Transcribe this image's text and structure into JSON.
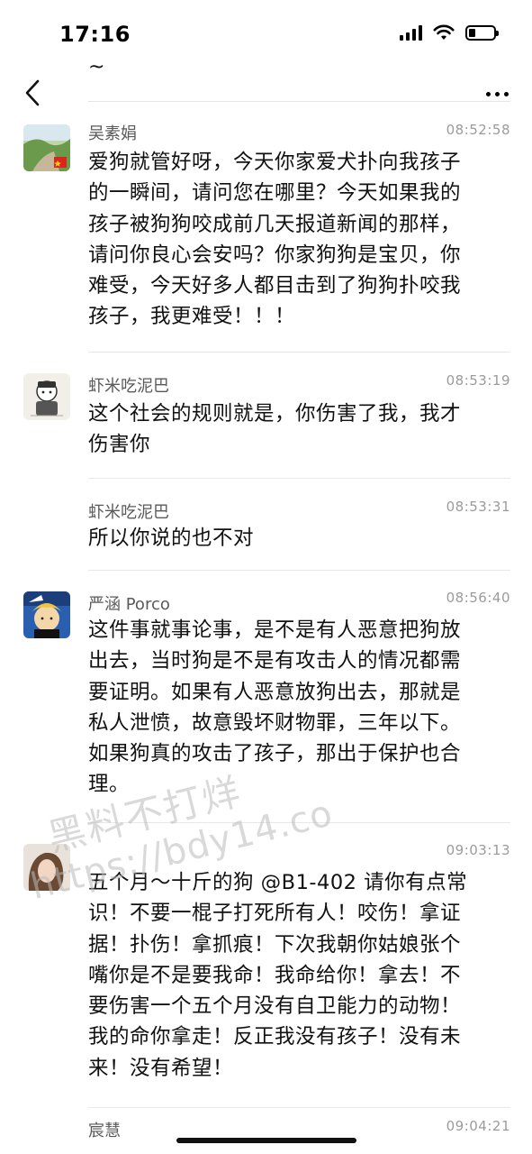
{
  "status_bar": {
    "time": "17:16",
    "battery_icon": "battery-icon",
    "wifi_icon": "wifi-icon",
    "signal_icon": "signal-icon"
  },
  "nav": {
    "tilde": "~",
    "back_icon": "chevron-left-icon",
    "more_icon": "more-horizontal-icon"
  },
  "comments": [
    {
      "name": "吴素娟",
      "time": "08:52:58",
      "text": "爱狗就管好呀，今天你家爱犬扑向我孩子\n的一瞬间，请问您在哪里？今天如果我的\n孩子被狗狗咬成前几天报道新闻的那样，\n请问你良心会安吗？你家狗狗是宝贝，你\n难受，今天好多人都目击到了狗狗扑咬我\n孩子，我更难受！！！"
    },
    {
      "name": "虾米吃泥巴",
      "time": "08:53:19",
      "text": "这个社会的规则就是，你伤害了我，我才\n伤害你"
    },
    {
      "name": "虾米吃泥巴",
      "time": "08:53:31",
      "text": "所以你说的也不对"
    },
    {
      "name": "严涵 Porco",
      "time": "08:56:40",
      "text": "这件事就事论事，是不是有人恶意把狗放\n出去，当时狗是不是有攻击人的情况都需\n要证明。如果有人恶意放狗出去，那就是\n私人泄愤，故意毁坏财物罪，三年以下。\n如果狗真的攻击了孩子，那出于保护也合\n理。"
    },
    {
      "name": "",
      "time": "09:03:13",
      "text": "五个月～十斤的狗 @B1-402 请你有点常\n识！不要一棍子打死所有人！咬伤！拿证\n据！扑伤！拿抓痕！下次我朝你姑娘张个\n嘴你是不是要我命！我命给你！拿去！不\n要伤害一个五个月没有自卫能力的动物！\n我的命你拿走！反正我没有孩子！没有未\n来！没有希望！"
    },
    {
      "name": "宸慧",
      "time": "09:04:21",
      "text": ""
    }
  ],
  "watermark": {
    "line1": "黑料不打烊",
    "line2": "https://bdy14.co"
  }
}
